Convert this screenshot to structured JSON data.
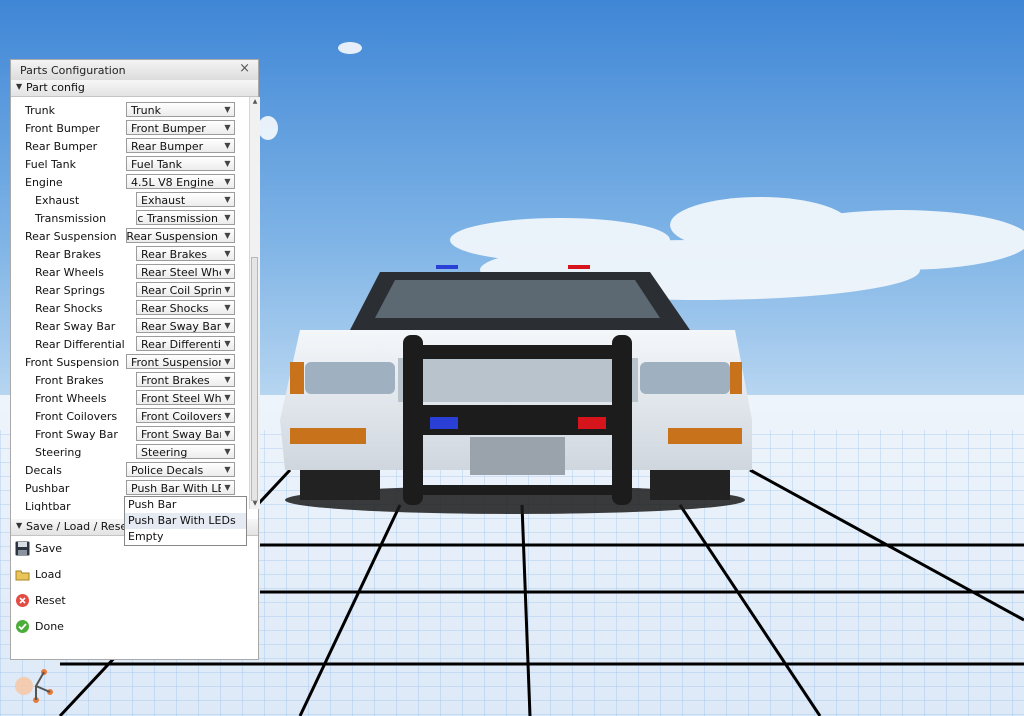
{
  "window": {
    "title": "Parts Configuration",
    "close_glyph": "×"
  },
  "sections": {
    "part_config": "Part config",
    "save_load_reset": "Save / Load / Reset"
  },
  "parts": [
    {
      "name": "Trunk",
      "value": "Trunk",
      "indent": 0
    },
    {
      "name": "Front Bumper",
      "value": "Front Bumper",
      "indent": 0
    },
    {
      "name": "Rear Bumper",
      "value": "Rear Bumper",
      "indent": 0
    },
    {
      "name": "Fuel Tank",
      "value": "Fuel Tank",
      "indent": 0
    },
    {
      "name": "Engine",
      "value": "4.5L V8 Engine",
      "indent": 0
    },
    {
      "name": "Exhaust",
      "value": "Exhaust",
      "indent": 1
    },
    {
      "name": "Transmission",
      "value": "tic Transmission",
      "indent": 1,
      "clipped": true
    },
    {
      "name": "Rear Suspension",
      "value": "e Rear Suspension",
      "indent": 0,
      "clipped": true
    },
    {
      "name": "Rear Brakes",
      "value": "Rear Brakes",
      "indent": 1
    },
    {
      "name": "Rear Wheels",
      "value": "Rear Steel Wheels",
      "indent": 1
    },
    {
      "name": "Rear Springs",
      "value": "Rear Coil Springs",
      "indent": 1
    },
    {
      "name": "Rear Shocks",
      "value": "Rear Shocks",
      "indent": 1
    },
    {
      "name": "Rear Sway Bar",
      "value": "Rear Sway Bar",
      "indent": 1
    },
    {
      "name": "Rear Differential",
      "value": "Rear Differential",
      "indent": 1
    },
    {
      "name": "Front Suspension",
      "value": "Front Suspension",
      "indent": 0
    },
    {
      "name": "Front Brakes",
      "value": "Front Brakes",
      "indent": 1
    },
    {
      "name": "Front Wheels",
      "value": "Front Steel Wheels",
      "indent": 1
    },
    {
      "name": "Front Coilovers",
      "value": "Front Coilovers",
      "indent": 1
    },
    {
      "name": "Front Sway Bar",
      "value": "Front Sway Bar",
      "indent": 1
    },
    {
      "name": "Steering",
      "value": "Steering",
      "indent": 1
    },
    {
      "name": "Decals",
      "value": "Police Decals",
      "indent": 0
    },
    {
      "name": "Pushbar",
      "value": "Push Bar With LEDs",
      "indent": 0
    },
    {
      "name": "Lightbar",
      "value": "",
      "indent": 0
    }
  ],
  "dropdown": {
    "options": [
      "Push Bar",
      "Push Bar With LEDs",
      "Empty"
    ],
    "highlighted": "Push Bar With LEDs"
  },
  "actions": [
    {
      "label": "Save",
      "icon": "floppy-disk-icon"
    },
    {
      "label": "Load",
      "icon": "folder-icon"
    },
    {
      "label": "Reset",
      "icon": "reset-icon"
    },
    {
      "label": "Done",
      "icon": "checkmark-icon"
    }
  ],
  "colors": {
    "sky": "#9ec6ea",
    "grid_floor": "#e9f1fb",
    "car_body": "#e9eef3",
    "accent_blue": "#2a3fd6",
    "accent_red": "#d6141c"
  }
}
